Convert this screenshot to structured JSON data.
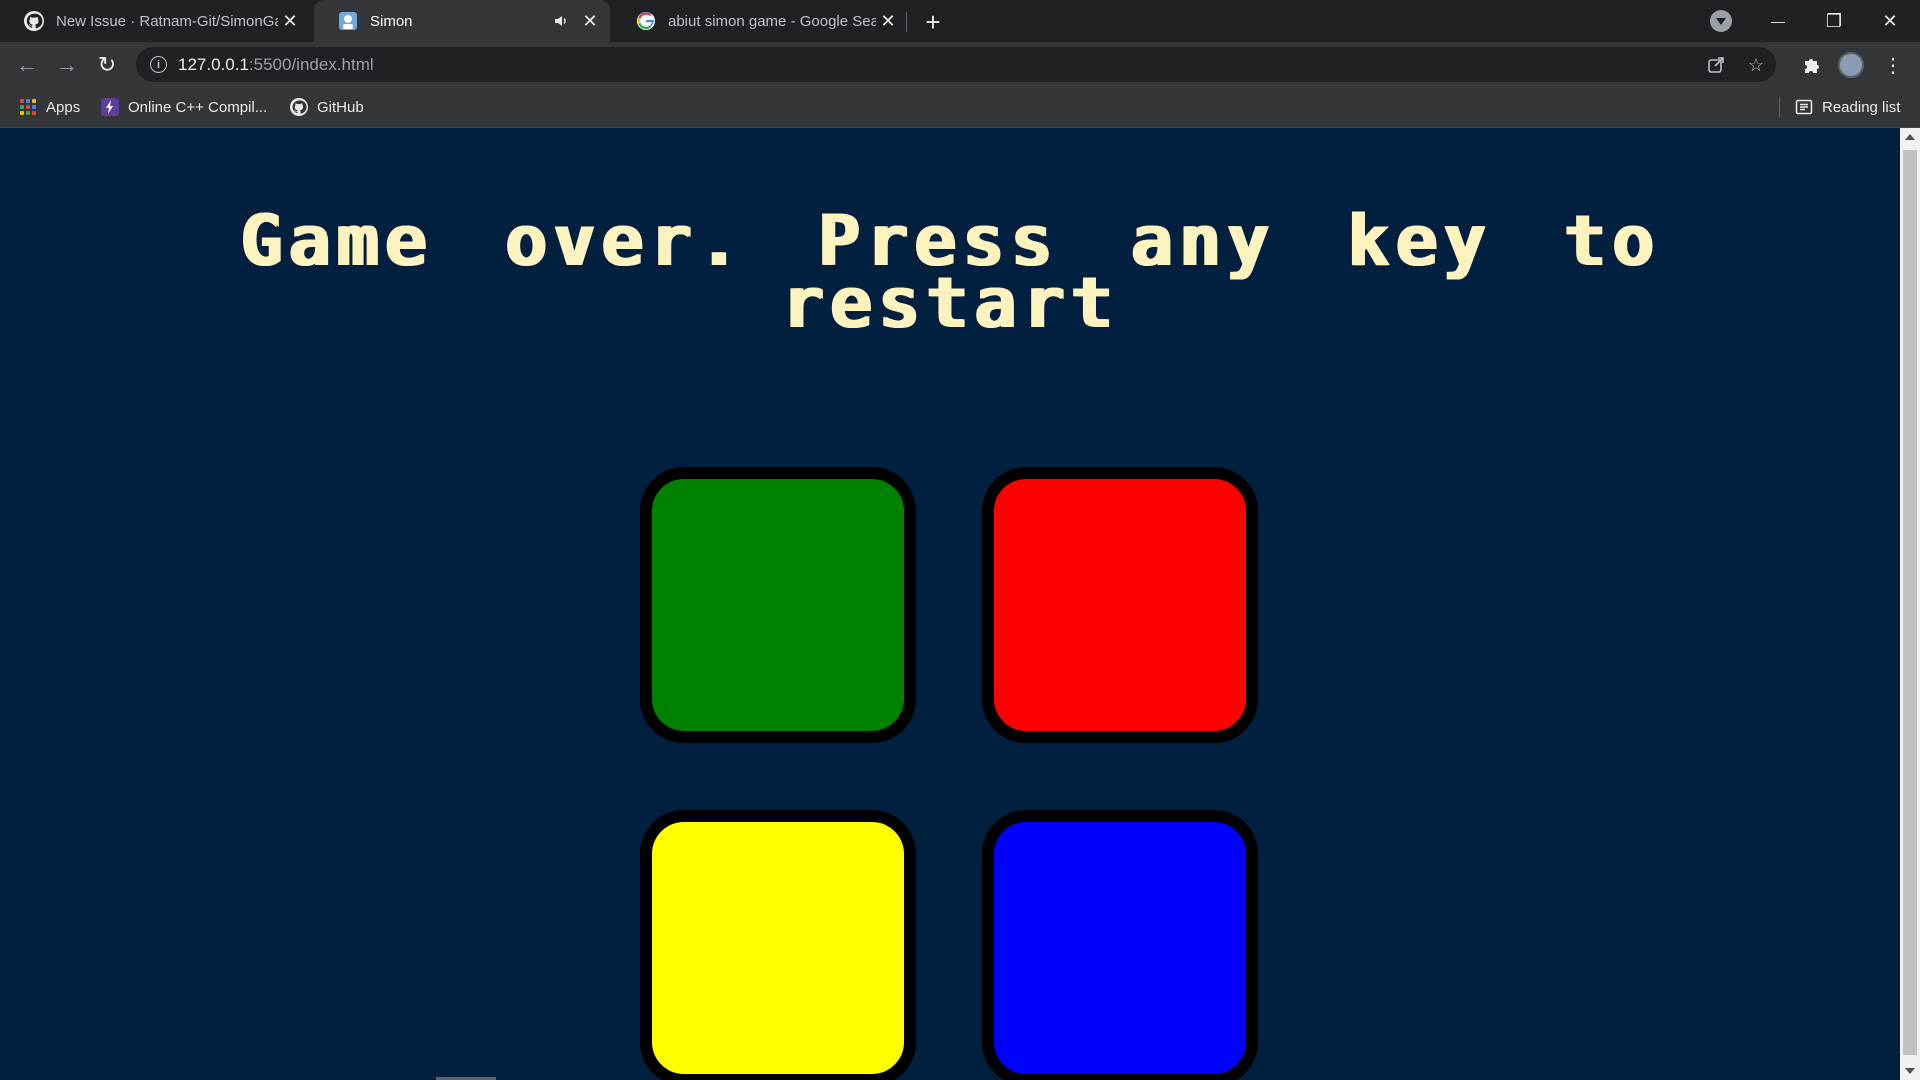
{
  "browser": {
    "tabs": [
      {
        "title": "New Issue · Ratnam-Git/SimonGame",
        "icon": "github-icon",
        "active": false
      },
      {
        "title": "Simon",
        "icon": "simon-favicon",
        "active": true,
        "audio": true
      },
      {
        "title": "abiut simon game - Google Search",
        "icon": "google-icon",
        "active": false
      }
    ],
    "new_tab_label": "+",
    "window_controls": {
      "minimize": "—",
      "restore": "❐",
      "close": "✕"
    },
    "url": {
      "host": "127.0.0.1",
      "path": ":5500/index.html"
    },
    "bookmarks": [
      {
        "label": "Apps",
        "icon": "apps-grid-icon"
      },
      {
        "label": "Online C++ Compil...",
        "icon": "lightning-icon"
      },
      {
        "label": "GitHub",
        "icon": "github-icon"
      }
    ],
    "reading_list_label": "Reading list"
  },
  "game": {
    "title": "Game over. Press any key to restart",
    "buttons": [
      {
        "id": "green",
        "color": "#008000"
      },
      {
        "id": "red",
        "color": "#ff0000"
      },
      {
        "id": "yellow",
        "color": "#ffff00"
      },
      {
        "id": "blue",
        "color": "#0000ff"
      }
    ],
    "background": "#011f3f",
    "title_color": "#fef2bf"
  }
}
